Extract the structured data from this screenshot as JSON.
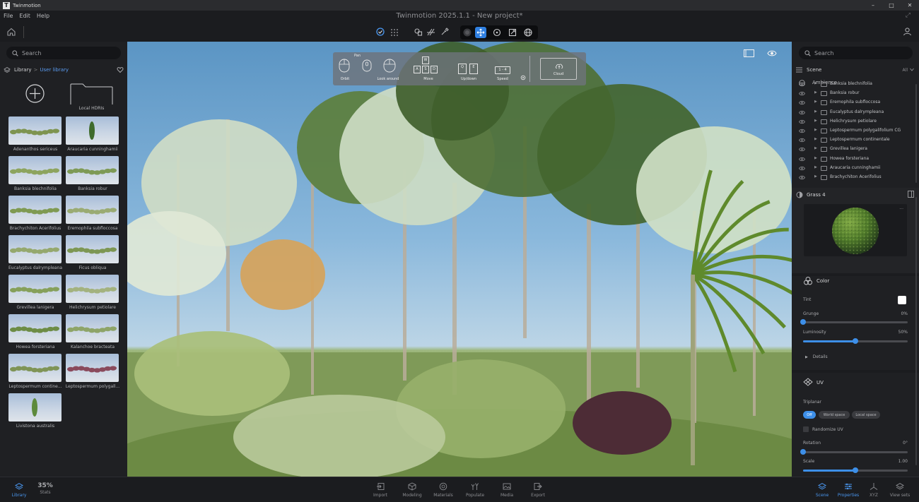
{
  "window": {
    "app_name": "Twinmotion",
    "title": "Twinmotion 2025.1.1 - New project*",
    "controls": [
      "–",
      "□",
      "✕"
    ]
  },
  "menu": [
    "File",
    "Edit",
    "Help"
  ],
  "left": {
    "search_placeholder": "Search",
    "breadcrumb": {
      "root": "Library",
      "separator": ">",
      "current": "User library"
    },
    "local_hdris": "Local HDRIs",
    "assets": [
      {
        "label": "Adenanthos sericeus",
        "kind": "shrub",
        "color": "#7e9450"
      },
      {
        "label": "Araucaria cunninghamii",
        "kind": "tree",
        "color": "#3f6b2c"
      },
      {
        "label": "Banksia blechnifolia",
        "kind": "shrub",
        "color": "#8da45e"
      },
      {
        "label": "Banksia robur",
        "kind": "shrub",
        "color": "#7e9a55"
      },
      {
        "label": "Brachychiton Acerifolius",
        "kind": "shrub",
        "color": "#7f9a52"
      },
      {
        "label": "Eremophila subfloccosa",
        "kind": "shrub",
        "color": "#9aab73"
      },
      {
        "label": "Eucalyptus dalrympleana",
        "kind": "shrub",
        "color": "#95a86d"
      },
      {
        "label": "Ficus obliqua",
        "kind": "shrub",
        "color": "#7d9753"
      },
      {
        "label": "Grevillea lanigera",
        "kind": "shrub",
        "color": "#86a05a"
      },
      {
        "label": "Helichrysum petiolare",
        "kind": "shrub",
        "color": "#a3b27f"
      },
      {
        "label": "Howea forsteriana",
        "kind": "shrub",
        "color": "#6d8c45"
      },
      {
        "label": "Kalanchoe bracteata",
        "kind": "shrub",
        "color": "#8ea468"
      },
      {
        "label": "Leptospermum contine...",
        "kind": "shrub",
        "color": "#7f9456"
      },
      {
        "label": "Leptospermum polygall...",
        "kind": "shrub",
        "color": "#8a4a5c"
      },
      {
        "label": "Livistona australis",
        "kind": "tree",
        "color": "#5d8a3c"
      }
    ]
  },
  "nav_help": {
    "pan": "Pan",
    "orbit": "Orbit",
    "look_around": "Look around",
    "move": "Move",
    "up_down": "Up/down",
    "speed": "Speed",
    "cloud": "Cloud",
    "keys_move": [
      "W",
      "A",
      "S",
      "D"
    ],
    "keys_ud": [
      "Q",
      "E"
    ],
    "keys_speed": "1 - 4"
  },
  "right": {
    "search_placeholder": "Search",
    "scene_label": "Scene",
    "filter_label": "All",
    "ambience_label": "Ambience",
    "items": [
      "Banksia blechnifolia",
      "Banksia robur",
      "Eremophila subfloccosa",
      "Eucalyptus dalrympleana",
      "Helichrysum petiolare",
      "Leptospermum polygalifolium CG",
      "Leptospermum continentale",
      "Grevillea lanigera",
      "Howea forsteriana",
      "Araucaria cunninghamii",
      "Brachychiton Acerifolius"
    ],
    "material_name": "Grass 4",
    "more": "...",
    "color_title": "Color",
    "tint_label": "Tint",
    "tint_color": "#ffffff",
    "grunge_label": "Grunge",
    "grunge_value": "0%",
    "grunge_fraction": 0.0,
    "luminosity_label": "Luminosity",
    "luminosity_value": "50%",
    "luminosity_fraction": 0.5,
    "details_label": "Details",
    "uv_title": "UV",
    "triplanar_label": "Triplanar",
    "triplanar_options": [
      "Off",
      "World space",
      "Local space"
    ],
    "triplanar_selected": "Off",
    "randomize_label": "Randomize UV",
    "rotation_label": "Rotation",
    "rotation_value": "0°",
    "rotation_fraction": 0.0,
    "scale_label": "Scale",
    "scale_value": "1.00",
    "scale_fraction": 0.5
  },
  "bottom": {
    "left": [
      {
        "label": "Library",
        "active": true
      },
      {
        "label": "Stats",
        "value": "35%"
      }
    ],
    "center": [
      "Import",
      "Modeling",
      "Materials",
      "Populate",
      "Media",
      "Export"
    ],
    "right": [
      {
        "label": "Scene",
        "active": true
      },
      {
        "label": "Properties",
        "active": true
      },
      {
        "label": "XYZ"
      },
      {
        "label": "View sets"
      }
    ]
  },
  "colors": {
    "accent": "#3d8fe8",
    "panel": "#1f2023",
    "toolbar": "#1b1c1f"
  }
}
